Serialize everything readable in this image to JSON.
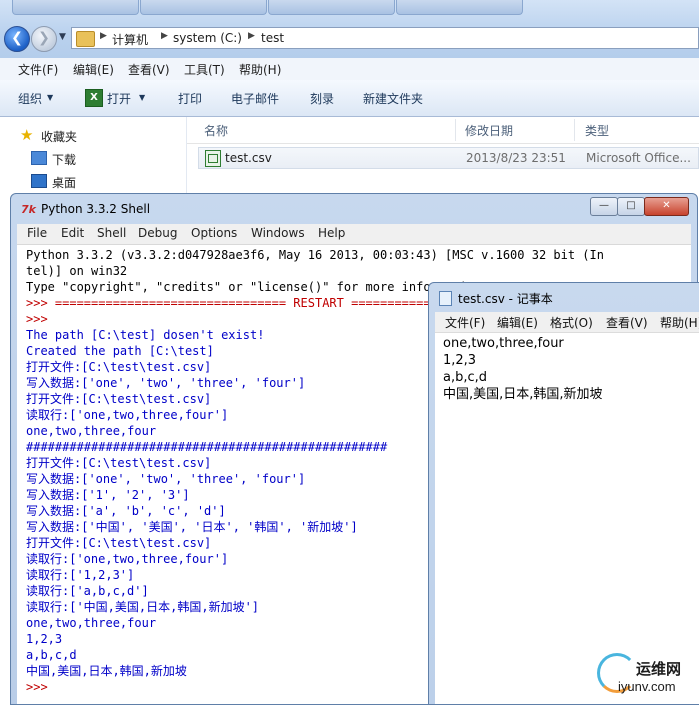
{
  "explorer": {
    "breadcrumb": [
      "计算机",
      "system (C:)",
      "test"
    ],
    "menu": [
      "文件(F)",
      "编辑(E)",
      "查看(V)",
      "工具(T)",
      "帮助(H)"
    ],
    "commands": {
      "organize": "组织",
      "open": "打开",
      "print": "打印",
      "email": "电子邮件",
      "burn": "刻录",
      "new_folder": "新建文件夹"
    },
    "nav": {
      "favorites": "收藏夹",
      "downloads": "下载",
      "desktop": "桌面"
    },
    "columns": {
      "name": "名称",
      "modified": "修改日期",
      "type": "类型"
    },
    "file": {
      "name": "test.csv",
      "modified": "2013/8/23 23:51",
      "type": "Microsoft Office..."
    }
  },
  "shell": {
    "title": "Python 3.3.2 Shell",
    "menu": [
      "File",
      "Edit",
      "Shell",
      "Debug",
      "Options",
      "Windows",
      "Help"
    ],
    "lines": [
      {
        "text": "Python 3.3.2 (v3.3.2:d047928ae3f6, May 16 2013, 00:03:43) [MSC v.1600 32 bit (In",
        "color": "black"
      },
      {
        "text": "tel)] on win32",
        "color": "black"
      },
      {
        "text": "Type \"copyright\", \"credits\" or \"license()\" for more information.",
        "color": "black"
      },
      {
        "text": ">>> ================================ RESTART ================================",
        "color": "red_prompt"
      },
      {
        "text": ">>> ",
        "color": "red"
      },
      {
        "text": "The path [C:\\test] dosen't exist!",
        "color": "blue"
      },
      {
        "text": "Created the path [C:\\test]",
        "color": "blue"
      },
      {
        "text": "打开文件:[C:\\test\\test.csv]",
        "color": "blue"
      },
      {
        "text": "写入数据:['one', 'two', 'three', 'four']",
        "color": "blue"
      },
      {
        "text": "打开文件:[C:\\test\\test.csv]",
        "color": "blue"
      },
      {
        "text": "读取行:['one,two,three,four']",
        "color": "blue"
      },
      {
        "text": "one,two,three,four",
        "color": "blue"
      },
      {
        "text": "##################################################",
        "color": "blue"
      },
      {
        "text": "打开文件:[C:\\test\\test.csv]",
        "color": "blue"
      },
      {
        "text": "写入数据:['one', 'two', 'three', 'four']",
        "color": "blue"
      },
      {
        "text": "写入数据:['1', '2', '3']",
        "color": "blue"
      },
      {
        "text": "写入数据:['a', 'b', 'c', 'd']",
        "color": "blue"
      },
      {
        "text": "写入数据:['中国', '美国', '日本', '韩国', '新加坡']",
        "color": "blue"
      },
      {
        "text": "打开文件:[C:\\test\\test.csv]",
        "color": "blue"
      },
      {
        "text": "读取行:['one,two,three,four']",
        "color": "blue"
      },
      {
        "text": "读取行:['1,2,3']",
        "color": "blue"
      },
      {
        "text": "读取行:['a,b,c,d']",
        "color": "blue"
      },
      {
        "text": "读取行:['中国,美国,日本,韩国,新加坡']",
        "color": "blue"
      },
      {
        "text": "one,two,three,four",
        "color": "blue"
      },
      {
        "text": "1,2,3",
        "color": "blue"
      },
      {
        "text": "a,b,c,d",
        "color": "blue"
      },
      {
        "text": "中国,美国,日本,韩国,新加坡",
        "color": "blue"
      },
      {
        "text": ">>> ",
        "color": "red"
      }
    ]
  },
  "notepad": {
    "title": "test.csv - 记事本",
    "menu": [
      "文件(F)",
      "编辑(E)",
      "格式(O)",
      "查看(V)",
      "帮助(H)"
    ],
    "lines": [
      "one,two,three,four",
      "1,2,3",
      "a,b,c,d",
      "中国,美国,日本,韩国,新加坡"
    ]
  },
  "watermark": {
    "cn": "运维网",
    "url": "iyunv.com"
  }
}
